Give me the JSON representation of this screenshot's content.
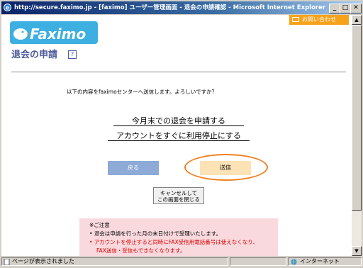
{
  "window": {
    "title": "http://secure.faximo.jp - [faximo] ユーザー管理画面 - 退会の申請確認 - Microsoft Internet Explorer",
    "min": "_",
    "max": "□",
    "close": "✕"
  },
  "header": {
    "logo_text": "Faximo",
    "contact_label": "お問い合わせ"
  },
  "page": {
    "title": "退会の申請",
    "help_icon": "?",
    "message": "以下の内容をfaximoセンターへ送信します。よろしいですか？",
    "option1": "今月末での退会を申請する",
    "option2": "アカウントをすぐに利用停止にする"
  },
  "buttons": {
    "back": "戻る",
    "send": "送信",
    "close_line1": "キャンセルして",
    "close_line2": "この画面を閉じる"
  },
  "note": {
    "title": "※ご注意",
    "item1": "退会は申請を行った月の末日付けで受理いたします。",
    "item2a": "アカウントを停止すると同時にFAX受信用電話番号は使えなくなり、",
    "item2b": "FAX送信・受信もできなくなります。"
  },
  "status": {
    "text": "ページが表示されました",
    "zone": "インターネット"
  },
  "colors": {
    "accent": "#3dafe0",
    "highlight": "#f08020",
    "warning": "#e00000"
  }
}
